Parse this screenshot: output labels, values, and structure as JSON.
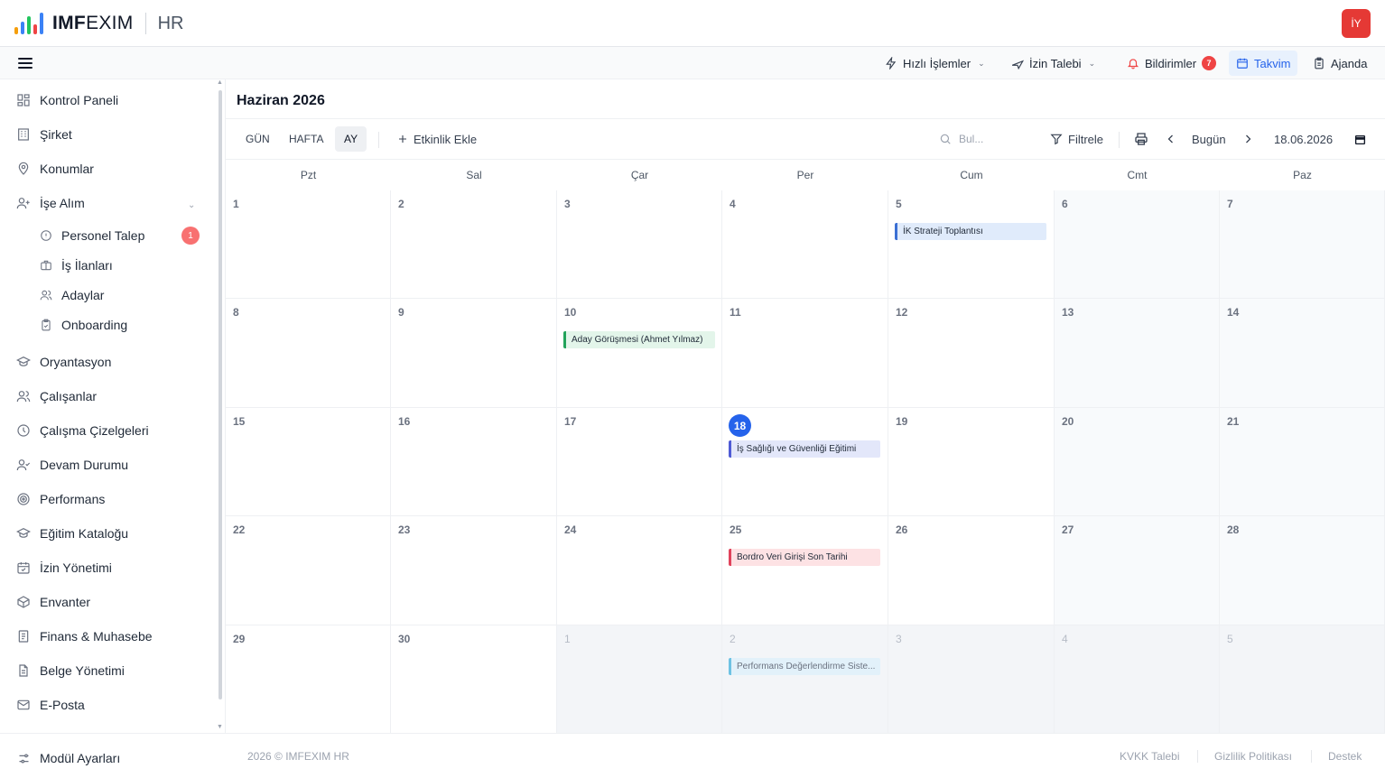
{
  "app": {
    "brand_bold": "IMF",
    "brand_light": "EXIM",
    "brand_suffix": "HR",
    "user_initials": "İY",
    "logo_colors": [
      "#f59e0b",
      "#3b82f6",
      "#22c55e",
      "#ef4444",
      "#3b82f6"
    ]
  },
  "toolbar": {
    "quick_actions": "Hızlı İşlemler",
    "leave_request": "İzin Talebi",
    "notifications": "Bildirimler",
    "notifications_count": "7",
    "calendar": "Takvim",
    "agenda": "Ajanda"
  },
  "sidebar": {
    "items": [
      {
        "label": "Kontrol Paneli",
        "icon": "dashboard-icon"
      },
      {
        "label": "Şirket",
        "icon": "building-icon"
      },
      {
        "label": "Konumlar",
        "icon": "location-pin-icon"
      },
      {
        "label": "İşe Alım",
        "icon": "user-plus-icon"
      },
      {
        "label": "Oryantasyon",
        "icon": "graduation-cap-icon"
      },
      {
        "label": "Çalışanlar",
        "icon": "users-icon"
      },
      {
        "label": "Çalışma Çizelgeleri",
        "icon": "clock-icon"
      },
      {
        "label": "Devam Durumu",
        "icon": "user-check-icon"
      },
      {
        "label": "Performans",
        "icon": "target-icon"
      },
      {
        "label": "Eğitim Kataloğu",
        "icon": "graduation-cap-icon"
      },
      {
        "label": "İzin Yönetimi",
        "icon": "calendar-check-icon"
      },
      {
        "label": "Envanter",
        "icon": "box-icon"
      },
      {
        "label": "Finans & Muhasebe",
        "icon": "ledger-icon"
      },
      {
        "label": "Belge Yönetimi",
        "icon": "document-icon"
      },
      {
        "label": "E-Posta",
        "icon": "mail-icon"
      }
    ],
    "sub_items": [
      {
        "label": "Personel Talep",
        "icon": "info-circle-icon",
        "badge": "1"
      },
      {
        "label": "İş İlanları",
        "icon": "briefcase-icon"
      },
      {
        "label": "Adaylar",
        "icon": "users-icon"
      },
      {
        "label": "Onboarding",
        "icon": "clipboard-icon"
      }
    ],
    "bottom": {
      "label": "Modül Ayarları",
      "icon": "sliders-icon"
    }
  },
  "calendar": {
    "title": "Haziran 2026",
    "views": [
      "GÜN",
      "HAFTA",
      "AY"
    ],
    "active_view": "AY",
    "add_event": "Etkinlik Ekle",
    "search_placeholder": "Bul...",
    "filter": "Filtrele",
    "today": "Bugün",
    "date_value": "18.06.2026",
    "weekdays": [
      "Pzt",
      "Sal",
      "Çar",
      "Per",
      "Cum",
      "Cmt",
      "Paz"
    ],
    "weeks": [
      [
        {
          "d": "1"
        },
        {
          "d": "2"
        },
        {
          "d": "3"
        },
        {
          "d": "4"
        },
        {
          "d": "5"
        },
        {
          "d": "6"
        },
        {
          "d": "7"
        }
      ],
      [
        {
          "d": "8"
        },
        {
          "d": "9"
        },
        {
          "d": "10"
        },
        {
          "d": "11"
        },
        {
          "d": "12"
        },
        {
          "d": "13"
        },
        {
          "d": "14"
        }
      ],
      [
        {
          "d": "15"
        },
        {
          "d": "16"
        },
        {
          "d": "17"
        },
        {
          "d": "18",
          "today": true
        },
        {
          "d": "19"
        },
        {
          "d": "20"
        },
        {
          "d": "21"
        }
      ],
      [
        {
          "d": "22"
        },
        {
          "d": "23"
        },
        {
          "d": "24"
        },
        {
          "d": "25"
        },
        {
          "d": "26"
        },
        {
          "d": "27"
        },
        {
          "d": "28"
        }
      ],
      [
        {
          "d": "29"
        },
        {
          "d": "30"
        },
        {
          "d": "1",
          "other": true
        },
        {
          "d": "2",
          "other": true
        },
        {
          "d": "3",
          "other": true
        },
        {
          "d": "4",
          "other": true
        },
        {
          "d": "5",
          "other": true
        }
      ]
    ],
    "events": [
      {
        "week": 0,
        "day": 4,
        "title": "İK Strateji Toplantısı",
        "bg": "#e0ebfb",
        "border": "#3b6fd4"
      },
      {
        "week": 1,
        "day": 2,
        "title": "Aday Görüşmesi (Ahmet Yılmaz)",
        "bg": "#e3f5ea",
        "border": "#22a35a"
      },
      {
        "week": 2,
        "day": 3,
        "title": "İş Sağlığı ve Güvenliği Eğitimi",
        "bg": "#e3e7fa",
        "border": "#4f5bd5"
      },
      {
        "week": 3,
        "day": 3,
        "title": "Bordro Veri Girişi Son Tarihi",
        "bg": "#fde2e4",
        "border": "#e0435c"
      },
      {
        "week": 4,
        "day": 3,
        "title": "Performans Değerlendirme Siste...",
        "bg": "#e2f1fa",
        "border": "#6ec2e3"
      }
    ]
  },
  "footer": {
    "copyright": "2026 © IMFEXIM HR",
    "links": [
      "KVKK Talebi",
      "Gizlilik Politikası",
      "Destek"
    ]
  }
}
